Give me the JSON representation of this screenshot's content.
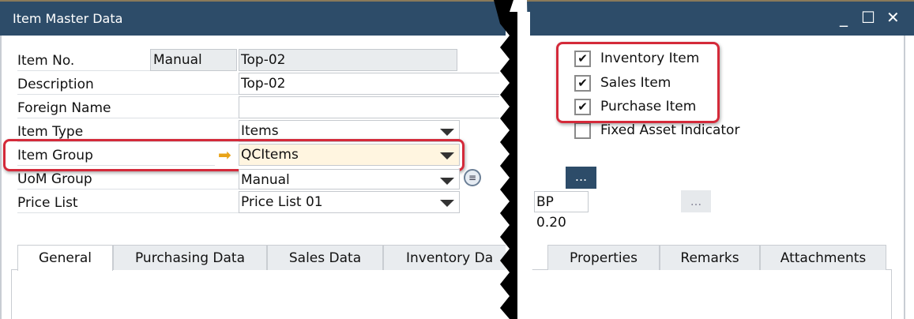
{
  "window": {
    "title": "Item Master Data",
    "minimize": "_",
    "maximize": "☐",
    "close": "✕"
  },
  "form": {
    "item_no": {
      "label": "Item No.",
      "series": "Manual",
      "value": "Top-02"
    },
    "description": {
      "label": "Description",
      "value": "Top-02"
    },
    "foreign_name": {
      "label": "Foreign Name",
      "value": ""
    },
    "item_type": {
      "label": "Item Type",
      "value": "Items"
    },
    "item_group": {
      "label": "Item Group",
      "value": "QCItems"
    },
    "uom_group": {
      "label": "UoM Group",
      "value": "Manual"
    },
    "price_list": {
      "label": "Price List",
      "value": "Price List 01"
    }
  },
  "checkboxes": [
    {
      "label": "Inventory Item",
      "checked": true
    },
    {
      "label": "Sales Item",
      "checked": true
    },
    {
      "label": "Purchase Item",
      "checked": true
    },
    {
      "label": "Fixed Asset Indicator",
      "checked": false
    }
  ],
  "right": {
    "browse_label": "...",
    "bp_value": "BP 0.20",
    "browse2_label": "..."
  },
  "tabs": [
    "General",
    "Purchasing Data",
    "Sales Data",
    "Inventory Da",
    "Properties",
    "Remarks",
    "Attachments"
  ],
  "colors": {
    "titlebar": "#2d4c69",
    "highlight": "#d42a3a",
    "active_field": "#fff5e0",
    "arrow": "#e8a317"
  }
}
